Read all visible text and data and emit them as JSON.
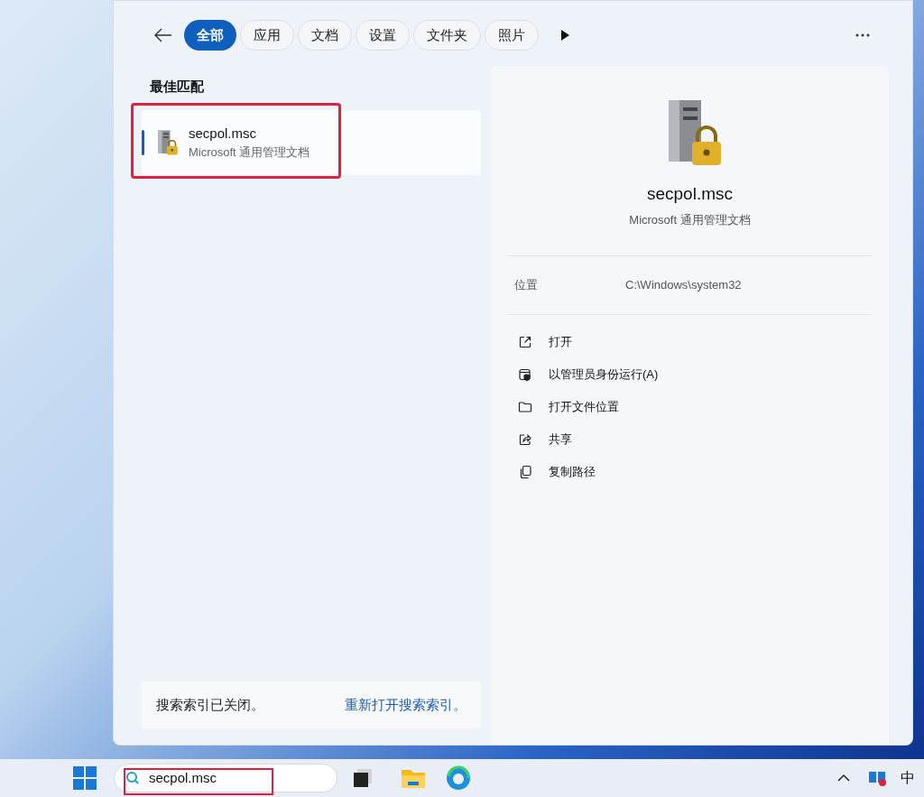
{
  "filters": [
    {
      "label": "全部",
      "selected": true
    },
    {
      "label": "应用",
      "selected": false
    },
    {
      "label": "文档",
      "selected": false
    },
    {
      "label": "设置",
      "selected": false
    },
    {
      "label": "文件夹",
      "selected": false
    },
    {
      "label": "照片",
      "selected": false
    }
  ],
  "best_match": {
    "heading": "最佳匹配",
    "result": {
      "name": "secpol.msc",
      "type": "Microsoft 通用管理文档",
      "selected": true,
      "annotated": true
    }
  },
  "index_notice": {
    "text": "搜索索引已关闭。",
    "link": "重新打开搜索索引。"
  },
  "preview": {
    "name": "secpol.msc",
    "type": "Microsoft 通用管理文档",
    "location_label": "位置",
    "location": "C:\\Windows\\system32",
    "actions": [
      {
        "kind": "open",
        "label": "打开"
      },
      {
        "kind": "admin",
        "label": "以管理员身份运行(A)"
      },
      {
        "kind": "folder",
        "label": "打开文件位置"
      },
      {
        "kind": "share",
        "label": "共享"
      },
      {
        "kind": "copy",
        "label": "复制路径"
      }
    ]
  },
  "taskbar": {
    "search_value": "secpol.msc",
    "search_annotated": true,
    "ime": "中"
  }
}
